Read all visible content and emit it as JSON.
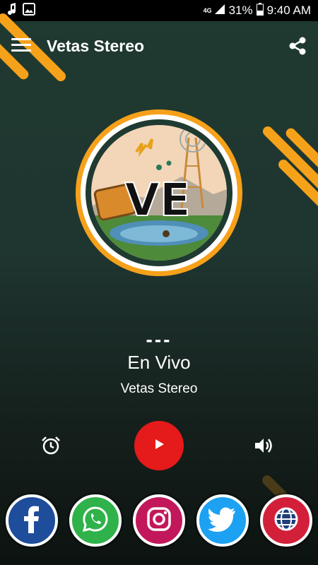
{
  "status_bar": {
    "network": "4G",
    "battery": "31%",
    "time": "9:40 AM",
    "icons": [
      "music-note-icon",
      "image-icon",
      "network-4g-icon",
      "signal-icon",
      "battery-icon"
    ]
  },
  "app_bar": {
    "title": "Vetas Stereo",
    "menu_icon": "hamburger-menu-icon",
    "share_icon": "share-icon"
  },
  "station_logo": {
    "lettering": "VE"
  },
  "now_playing": {
    "separator": "---",
    "title": "En Vivo",
    "station": "Vetas Stereo"
  },
  "controls": {
    "alarm_icon": "alarm-clock-icon",
    "play_icon": "play-icon",
    "volume_icon": "volume-icon"
  },
  "social": [
    {
      "name": "facebook",
      "icon": "facebook-icon",
      "color": "#1e4d9b"
    },
    {
      "name": "whatsapp",
      "icon": "whatsapp-icon",
      "color": "#2fb24a"
    },
    {
      "name": "instagram",
      "icon": "instagram-icon",
      "color": "#c2185b"
    },
    {
      "name": "twitter",
      "icon": "twitter-icon",
      "color": "#1da1f2"
    },
    {
      "name": "website",
      "icon": "globe-icon",
      "color": "#d3203a"
    }
  ],
  "colors": {
    "accent": "#f6a11a",
    "play_button": "#e51a1a",
    "background_top": "#1f3a30",
    "background_bottom": "#0c1310"
  }
}
